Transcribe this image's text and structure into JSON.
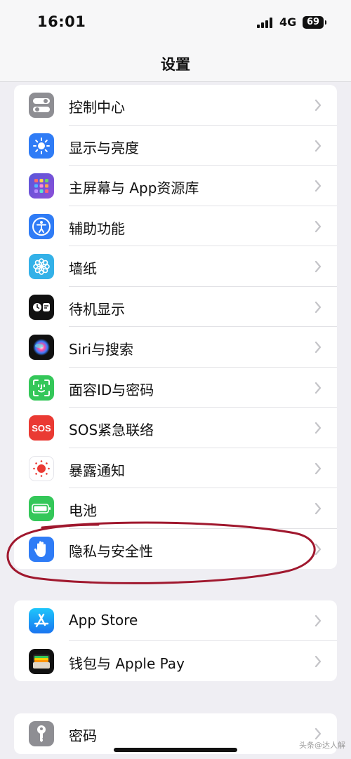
{
  "status_bar": {
    "time": "16:01",
    "network": "4G",
    "battery": "69"
  },
  "header": {
    "title": "设置"
  },
  "group1": {
    "items": [
      {
        "label": "控制中心"
      },
      {
        "label": "显示与亮度"
      },
      {
        "label": "主屏幕与 App资源库"
      },
      {
        "label": "辅助功能"
      },
      {
        "label": "墙纸"
      },
      {
        "label": "待机显示"
      },
      {
        "label": "Siri与搜索"
      },
      {
        "label": "面容ID与密码"
      },
      {
        "label": "SOS紧急联络"
      },
      {
        "label": "暴露通知"
      },
      {
        "label": "电池"
      },
      {
        "label": "隐私与安全性"
      }
    ]
  },
  "group2": {
    "items": [
      {
        "label": "App Store"
      },
      {
        "label": "钱包与 Apple Pay"
      }
    ]
  },
  "group3": {
    "items": [
      {
        "label": "密码"
      }
    ]
  },
  "icons": {
    "sos_text": "SOS"
  },
  "watermark": "头条@达人解",
  "colors": {
    "annotation": "#a0182e",
    "blue": "#2f7cf6",
    "green": "#34c759",
    "red": "#ea3a33"
  }
}
